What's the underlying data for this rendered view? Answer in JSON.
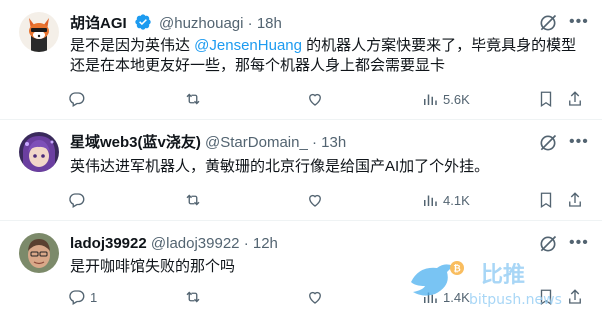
{
  "tweets": [
    {
      "name": "胡诌AGI",
      "handle": "@huzhouagi",
      "sep": "·",
      "time": "18h",
      "text_a": "是不是因为英伟达 ",
      "mention": "@JensenHuang",
      "text_b": " 的机器人方案快要来了，毕竟具身的模型还是在本地更友好一些，那每个机器人身上都会需要显卡",
      "replies": "",
      "reposts": "",
      "likes": "",
      "views": "5.6K"
    },
    {
      "name": "星域web3(蓝v浇友)",
      "handle": "@StarDomain_",
      "sep": "·",
      "time": "13h",
      "text": "英伟达进军机器人，黄敏珊的北京行像是给国产AI加了个外挂。",
      "replies": "",
      "reposts": "",
      "likes": "",
      "views": "4.1K"
    },
    {
      "name": "ladoj39922",
      "handle": "@ladoj39922",
      "sep": "·",
      "time": "12h",
      "text": "是开咖啡馆失败的那个吗",
      "replies": "1",
      "reposts": "",
      "likes": "",
      "views": "1.4K"
    }
  ],
  "watermark": {
    "brand": "比推",
    "domain": "bitpush.news"
  },
  "colors": {
    "accent": "#1d9bf0",
    "muted": "#536471",
    "text": "#0f1419",
    "divider": "#eff3f4"
  }
}
